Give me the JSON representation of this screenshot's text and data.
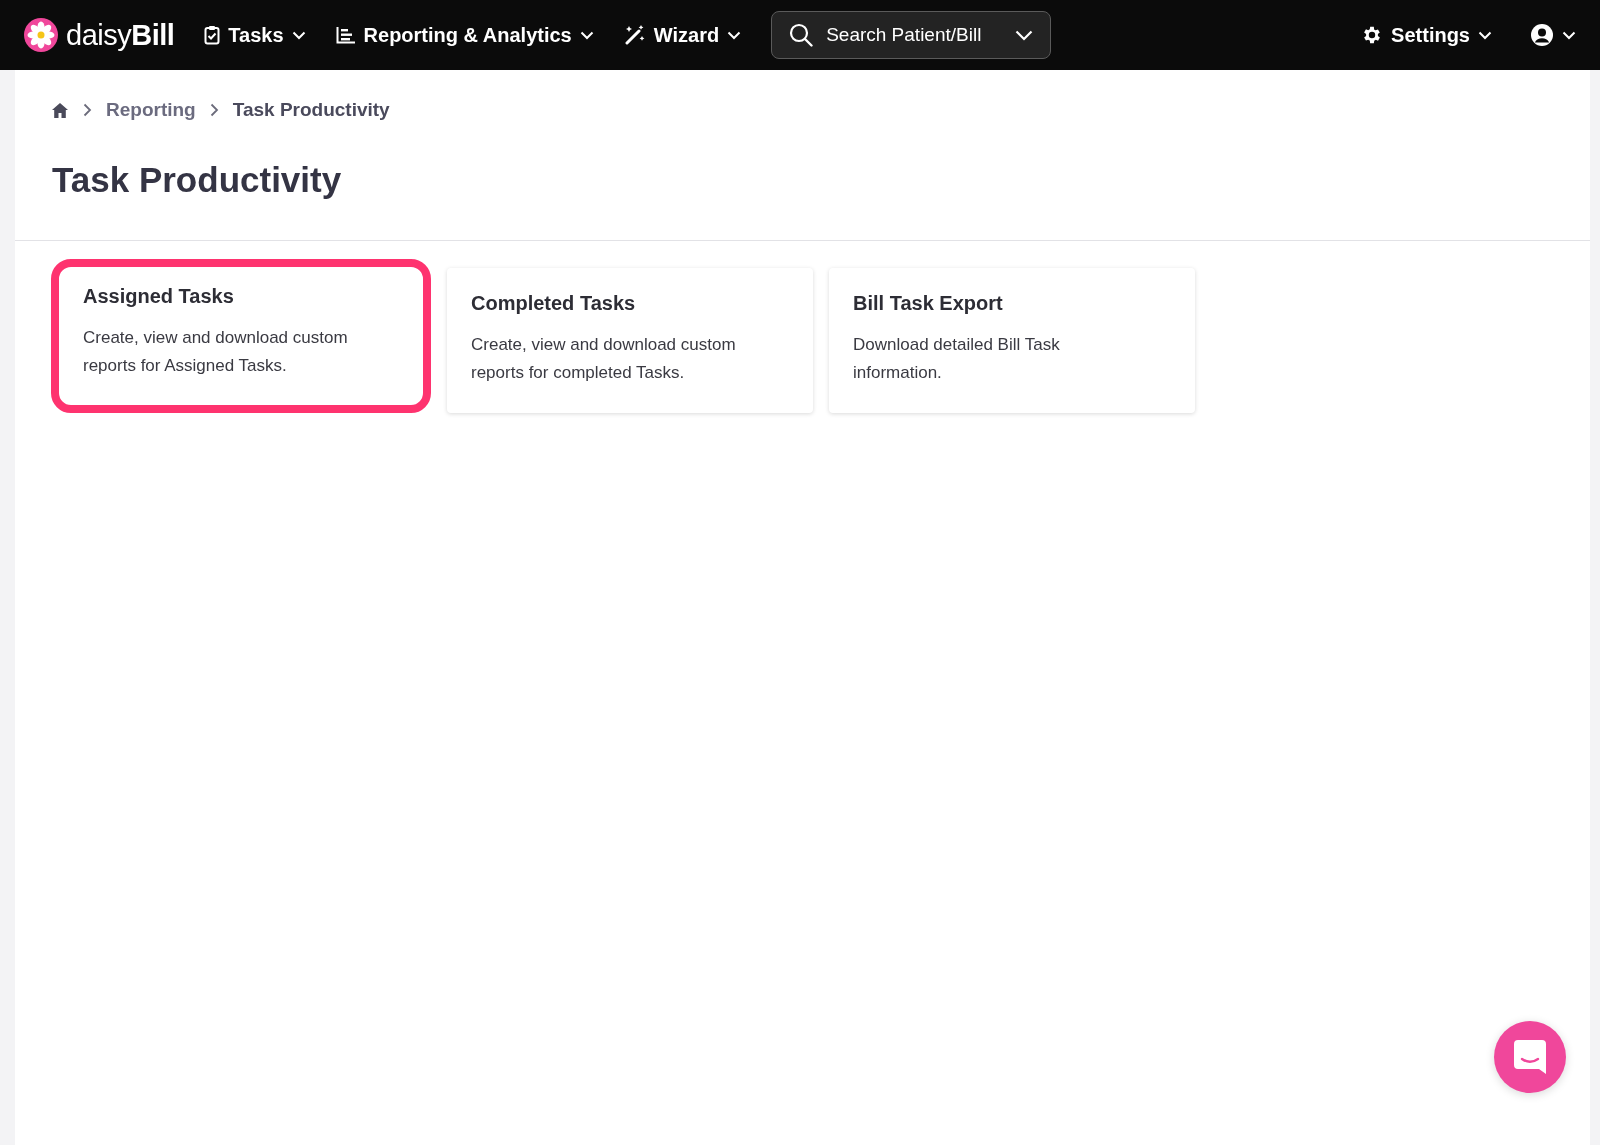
{
  "navbar": {
    "logo": "daisy**Bill**",
    "menus": [
      {
        "label": "Tasks"
      },
      {
        "label": "Reporting & Analytics"
      },
      {
        "label": "Wizard"
      }
    ],
    "search": {
      "placeholder": "Search Patient/Bill"
    },
    "settings": {
      "label": "Settings"
    }
  },
  "breadcrumb": [
    "Reporting",
    "Task Productivity"
  ],
  "page_title": "Task Productivity",
  "cards": [
    {
      "title": "Assigned Tasks",
      "description": "Create, view and download custom reports for Assigned Tasks.",
      "highlighted": true
    },
    {
      "title": "Completed Tasks",
      "description": "Create, view and download custom reports for completed Tasks.",
      "highlighted": false
    },
    {
      "title": "Bill Task Export",
      "description": "Download detailed Bill Task information.",
      "highlighted": false
    }
  ]
}
